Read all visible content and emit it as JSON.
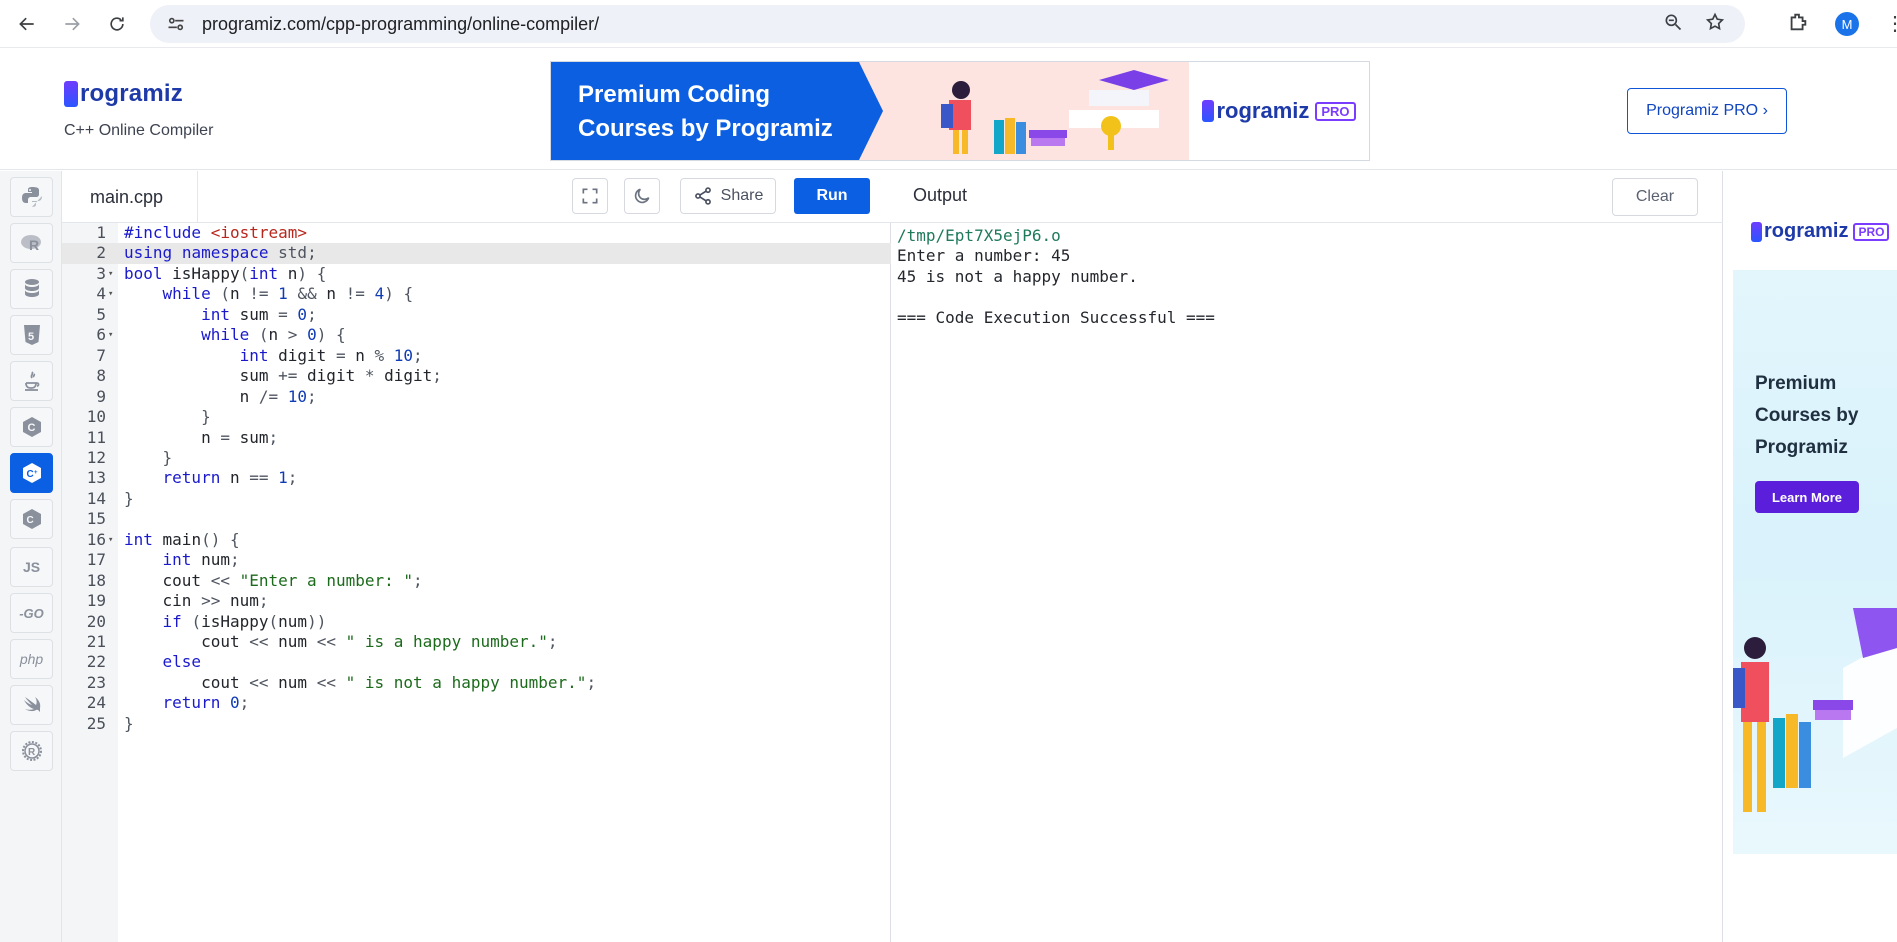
{
  "browser": {
    "url": "programiz.com/cpp-programming/online-compiler/",
    "profile_initial": "M"
  },
  "header": {
    "logo_text": "rogramiz",
    "subtitle": "C++ Online Compiler",
    "banner_text": "Premium Coding Courses by Programiz",
    "banner_brand": "rogramiz",
    "banner_tag": "PRO",
    "pro_button_label": "Programiz PRO ›"
  },
  "sidebar": {
    "items": [
      {
        "icon": "python-icon",
        "label": ""
      },
      {
        "icon": "r-lang-icon",
        "label": ""
      },
      {
        "icon": "sql-database-icon",
        "label": ""
      },
      {
        "icon": "html5-icon",
        "label": ""
      },
      {
        "icon": "java-icon",
        "label": ""
      },
      {
        "icon": "c-lang-icon",
        "label": ""
      },
      {
        "icon": "cpp-lang-icon",
        "label": ""
      },
      {
        "icon": "csharp-lang-icon",
        "label": ""
      },
      {
        "icon": "javascript-icon",
        "label": "JS"
      },
      {
        "icon": "go-lang-icon",
        "label": "-GO"
      },
      {
        "icon": "php-icon",
        "label": "php"
      },
      {
        "icon": "swift-icon",
        "label": ""
      },
      {
        "icon": "rust-icon",
        "label": ""
      }
    ],
    "active_index": 6
  },
  "editor": {
    "file_name": "main.cpp",
    "share_label": "Share",
    "run_label": "Run",
    "current_line": 2,
    "lines": [
      "#include <iostream>",
      "using namespace std;",
      "bool isHappy(int n) {",
      "    while (n != 1 && n != 4) {",
      "        int sum = 0;",
      "        while (n > 0) {",
      "            int digit = n % 10;",
      "            sum += digit * digit;",
      "            n /= 10;",
      "        }",
      "        n = sum;",
      "    }",
      "    return n == 1;",
      "}",
      "",
      "int main() {",
      "    int num;",
      "    cout << \"Enter a number: \";",
      "    cin >> num;",
      "    if (isHappy(num))",
      "        cout << num << \" is a happy number.\";",
      "    else",
      "        cout << num << \" is not a happy number.\";",
      "    return 0;",
      "}"
    ],
    "fold_lines": [
      3,
      4,
      6,
      16
    ]
  },
  "output": {
    "title": "Output",
    "clear_label": "Clear",
    "lines": [
      "/tmp/Ept7X5ejP6.o",
      "Enter a number: 45",
      "45 is not a happy number.",
      "",
      "=== Code Execution Successful ==="
    ]
  },
  "ad": {
    "brand": "rogramiz",
    "tag": "PRO",
    "text": "Premium Courses by Programiz",
    "button_label": "Learn More"
  },
  "colors": {
    "accent": "#0b5fe3",
    "brand_purple": "#7a3cff",
    "ad_button": "#5b1fdc"
  }
}
